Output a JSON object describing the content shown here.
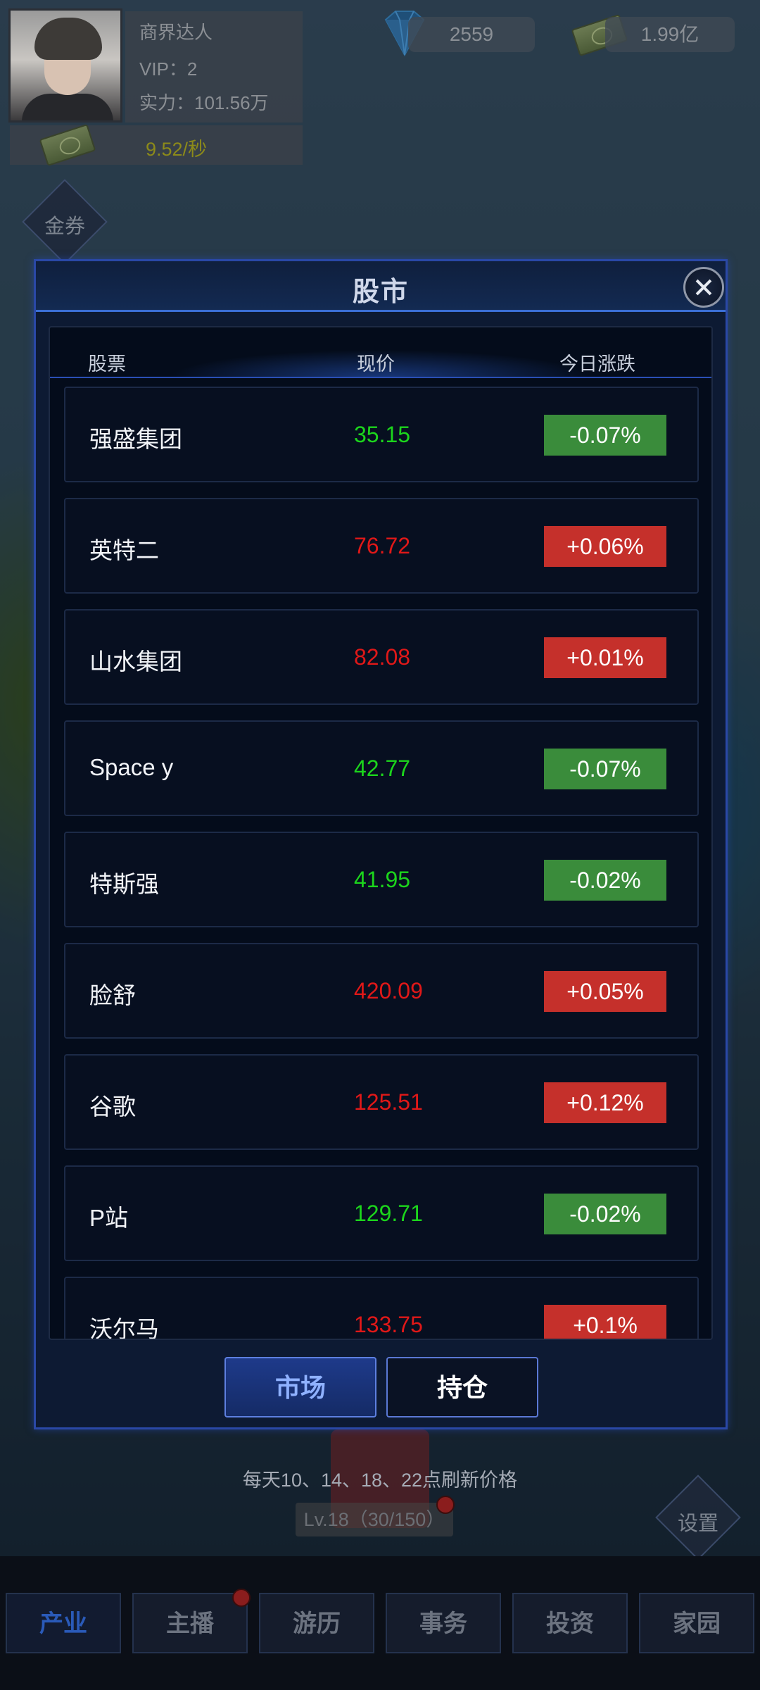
{
  "player": {
    "title": "商界达人",
    "vip": "VIP：2",
    "power": "实力：101.56万",
    "income_rate": "9.52/秒"
  },
  "resources": {
    "diamonds": "2559",
    "cash": "1.99亿"
  },
  "side_buttons": {
    "coupon": "金券",
    "settings": "设置"
  },
  "modal": {
    "title": "股市",
    "columns": {
      "stock": "股票",
      "price": "现价",
      "change": "今日涨跌"
    },
    "rows": [
      {
        "name": "强盛集团",
        "price": "35.15",
        "change": "-0.07%",
        "trend": "down"
      },
      {
        "name": "英特二",
        "price": "76.72",
        "change": "+0.06%",
        "trend": "up"
      },
      {
        "name": "山水集团",
        "price": "82.08",
        "change": "+0.01%",
        "trend": "up"
      },
      {
        "name": "Space y",
        "price": "42.77",
        "change": "-0.07%",
        "trend": "down"
      },
      {
        "name": "特斯强",
        "price": "41.95",
        "change": "-0.02%",
        "trend": "down"
      },
      {
        "name": "脸舒",
        "price": "420.09",
        "change": "+0.05%",
        "trend": "up"
      },
      {
        "name": "谷歌",
        "price": "125.51",
        "change": "+0.12%",
        "trend": "up"
      },
      {
        "name": "P站",
        "price": "129.71",
        "change": "-0.02%",
        "trend": "down"
      },
      {
        "name": "沃尔马",
        "price": "133.75",
        "change": "+0.1%",
        "trend": "up"
      }
    ],
    "tabs": {
      "market": "市场",
      "holdings": "持仓"
    }
  },
  "refresh_note": "每天10、14、18、22点刷新价格",
  "level": "Lv.18（30/150）",
  "bottom_nav": [
    "产业",
    "主播",
    "游历",
    "事务",
    "投资",
    "家园"
  ],
  "colors": {
    "up_text": "#e01818",
    "down_text": "#1cd51c",
    "up_badge": "#c5302b",
    "down_badge": "#3a8c3b",
    "accent": "#2a48a6"
  },
  "icons": {
    "diamond": "diamond-icon",
    "cash": "cash-stack-icon",
    "close": "close-icon",
    "gift": "gift-icon"
  }
}
